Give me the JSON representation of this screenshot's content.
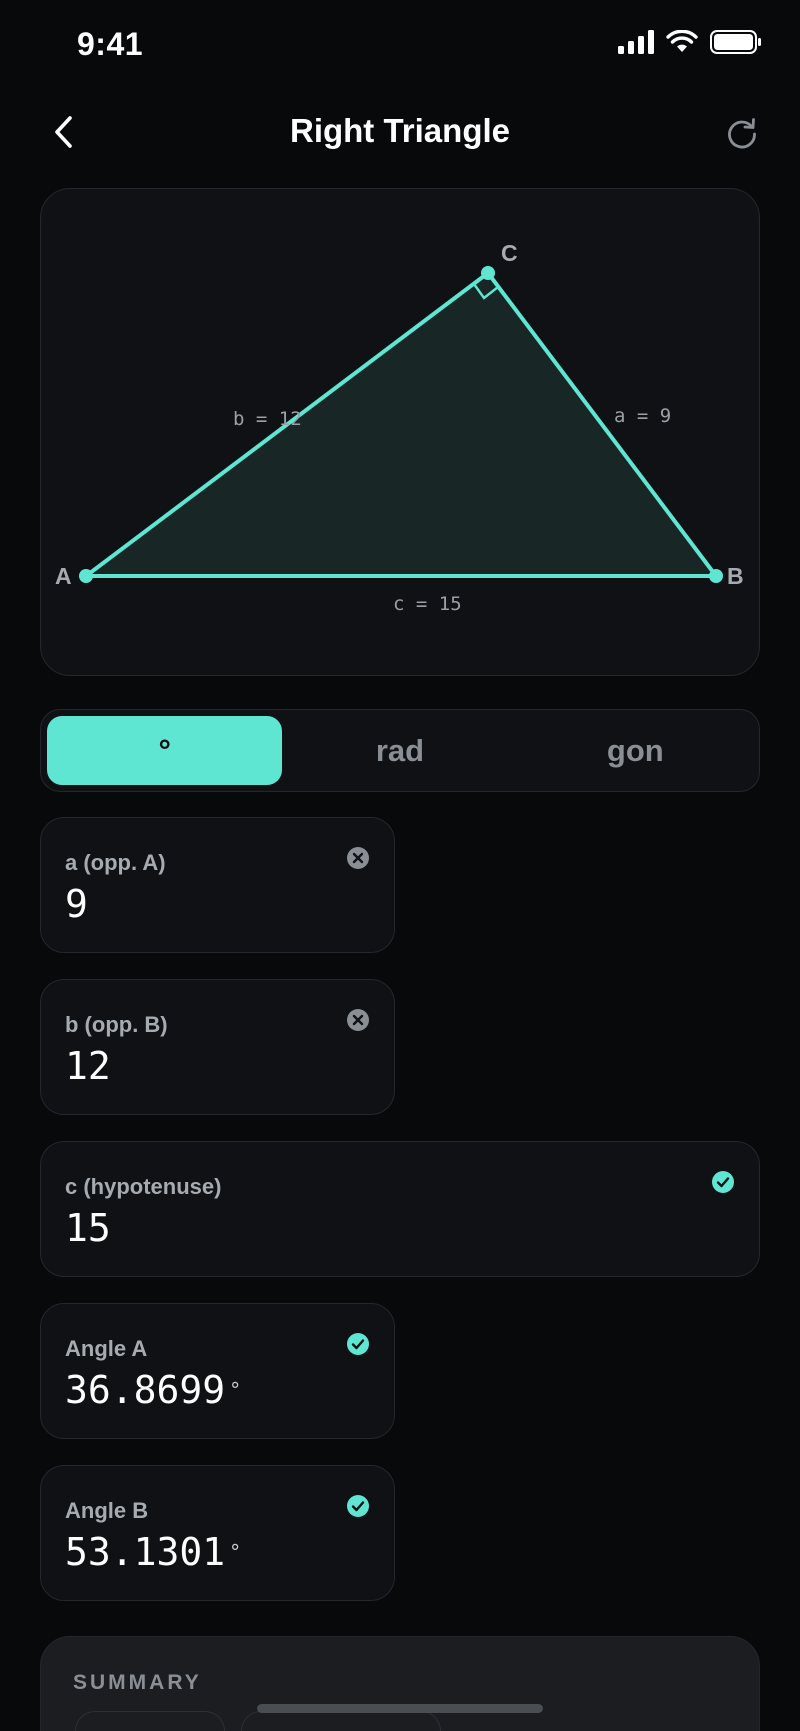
{
  "status": {
    "time": "9:41"
  },
  "nav": {
    "title": "Right Triangle"
  },
  "triangle": {
    "vertices": {
      "a": "A",
      "b": "B",
      "c": "C"
    },
    "side_labels": {
      "a": "a = 9",
      "b": "b = 12",
      "c": "c = 15"
    },
    "accent_color": "#5ee6d2"
  },
  "units": {
    "items": [
      "°",
      "rad",
      "gon"
    ],
    "selected": "°"
  },
  "fields": {
    "a": {
      "label": "a (opp. A)",
      "value": "9",
      "state": "clearable"
    },
    "b": {
      "label": "b (opp. B)",
      "value": "12",
      "state": "clearable"
    },
    "c": {
      "label": "c (hypotenuse)",
      "value": "15",
      "state": "computed"
    },
    "angle_a": {
      "label": "Angle A",
      "value": "36.8699",
      "unit": "°",
      "state": "computed"
    },
    "angle_b": {
      "label": "Angle B",
      "value": "53.1301",
      "unit": "°",
      "state": "computed"
    }
  },
  "summary": {
    "title": "SUMMARY"
  }
}
